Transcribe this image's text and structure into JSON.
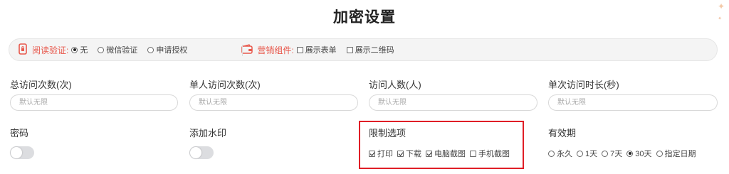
{
  "page": {
    "title": "加密设置"
  },
  "options_bar": {
    "read_verify": {
      "label": "阅读验证:",
      "options": [
        {
          "label": "无",
          "selected": true
        },
        {
          "label": "微信验证",
          "selected": false
        },
        {
          "label": "申请授权",
          "selected": false
        }
      ]
    },
    "marketing": {
      "label": "营销组件:",
      "options": [
        {
          "label": "展示表单",
          "checked": false
        },
        {
          "label": "展示二维码",
          "checked": false
        }
      ]
    },
    "accent_color": "#e8584c"
  },
  "fields": {
    "total_visits": {
      "label": "总访问次数(次)",
      "placeholder": "默认无限"
    },
    "single_visits": {
      "label": "单人访问次数(次)",
      "placeholder": "默认无限"
    },
    "visitors": {
      "label": "访问人数(人)",
      "placeholder": "默认无限"
    },
    "duration": {
      "label": "单次访问时长(秒)",
      "placeholder": "默认无限"
    },
    "password": {
      "label": "密码",
      "enabled": false
    },
    "watermark": {
      "label": "添加水印",
      "enabled": false
    },
    "restrictions": {
      "label": "限制选项",
      "options": [
        {
          "label": "打印",
          "checked": true
        },
        {
          "label": "下载",
          "checked": true
        },
        {
          "label": "电脑截图",
          "checked": true
        },
        {
          "label": "手机截图",
          "checked": false
        }
      ]
    },
    "validity": {
      "label": "有效期",
      "options": [
        {
          "label": "永久",
          "selected": false
        },
        {
          "label": "1天",
          "selected": false
        },
        {
          "label": "7天",
          "selected": false
        },
        {
          "label": "30天",
          "selected": true
        },
        {
          "label": "指定日期",
          "selected": false
        }
      ]
    }
  },
  "highlight_color": "#e01e26"
}
